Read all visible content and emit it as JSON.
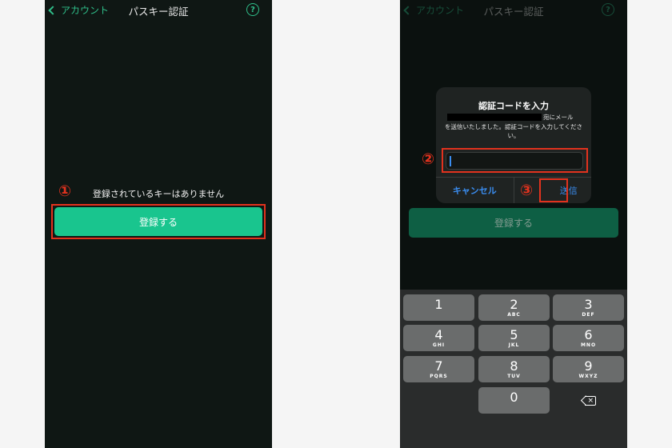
{
  "nav": {
    "back_label": "アカウント",
    "title": "パスキー認証",
    "help_glyph": "?"
  },
  "left": {
    "empty_message": "登録されているキーはありません",
    "register_button": "登録する",
    "step1": "①"
  },
  "right": {
    "register_button": "登録する",
    "dialog": {
      "title": "認証コードを入力",
      "line1_suffix": "宛にメール",
      "message": "を送信いたしました。認証コードを入力してください。",
      "input_value": "",
      "cancel_label": "キャンセル",
      "send_label": "送信"
    },
    "step2": "②",
    "step3": "③"
  },
  "keypad": {
    "keys": [
      {
        "digit": "1",
        "letters": ""
      },
      {
        "digit": "2",
        "letters": "ABC"
      },
      {
        "digit": "3",
        "letters": "DEF"
      },
      {
        "digit": "4",
        "letters": "GHI"
      },
      {
        "digit": "5",
        "letters": "JKL"
      },
      {
        "digit": "6",
        "letters": "MNO"
      },
      {
        "digit": "7",
        "letters": "PQRS"
      },
      {
        "digit": "8",
        "letters": "TUV"
      },
      {
        "digit": "9",
        "letters": "WXYZ"
      },
      {
        "digit": "0",
        "letters": ""
      }
    ],
    "delete_icon": "backspace-icon"
  },
  "colors": {
    "accent_green": "#19c58e",
    "highlight_red": "#e2321e",
    "link_blue": "#3a8df0"
  }
}
